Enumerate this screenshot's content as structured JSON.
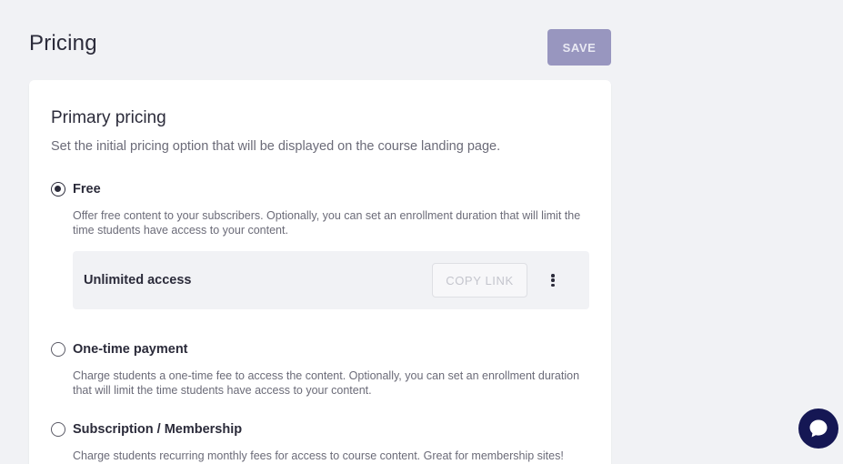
{
  "page": {
    "title": "Pricing",
    "save_label": "SAVE"
  },
  "primary_pricing": {
    "title": "Primary pricing",
    "subtitle": "Set the initial pricing option that will be displayed on the course landing page.",
    "options": [
      {
        "label": "Free",
        "checked": true,
        "description": "Offer free content to your subscribers. Optionally, you can set an enrollment duration that will limit the time students have access to your content.",
        "access": {
          "label": "Unlimited access",
          "copy_link_label": "COPY LINK",
          "more_icon": "more-vertical-icon"
        }
      },
      {
        "label": "One-time payment",
        "checked": false,
        "description": "Charge students a one-time fee to access the content. Optionally, you can set an enrollment duration that will limit the time students have access to your content."
      },
      {
        "label": "Subscription / Membership",
        "checked": false,
        "description": "Charge students recurring monthly fees for access to course content. Great for membership sites!"
      }
    ]
  },
  "chat": {
    "icon": "chat-bubble-icon"
  },
  "colors": {
    "background": "#f1f2f5",
    "save_button": "#9896bf",
    "chat_button": "#151754",
    "text_primary": "#2b2b3a",
    "text_secondary": "#6b6b78"
  }
}
